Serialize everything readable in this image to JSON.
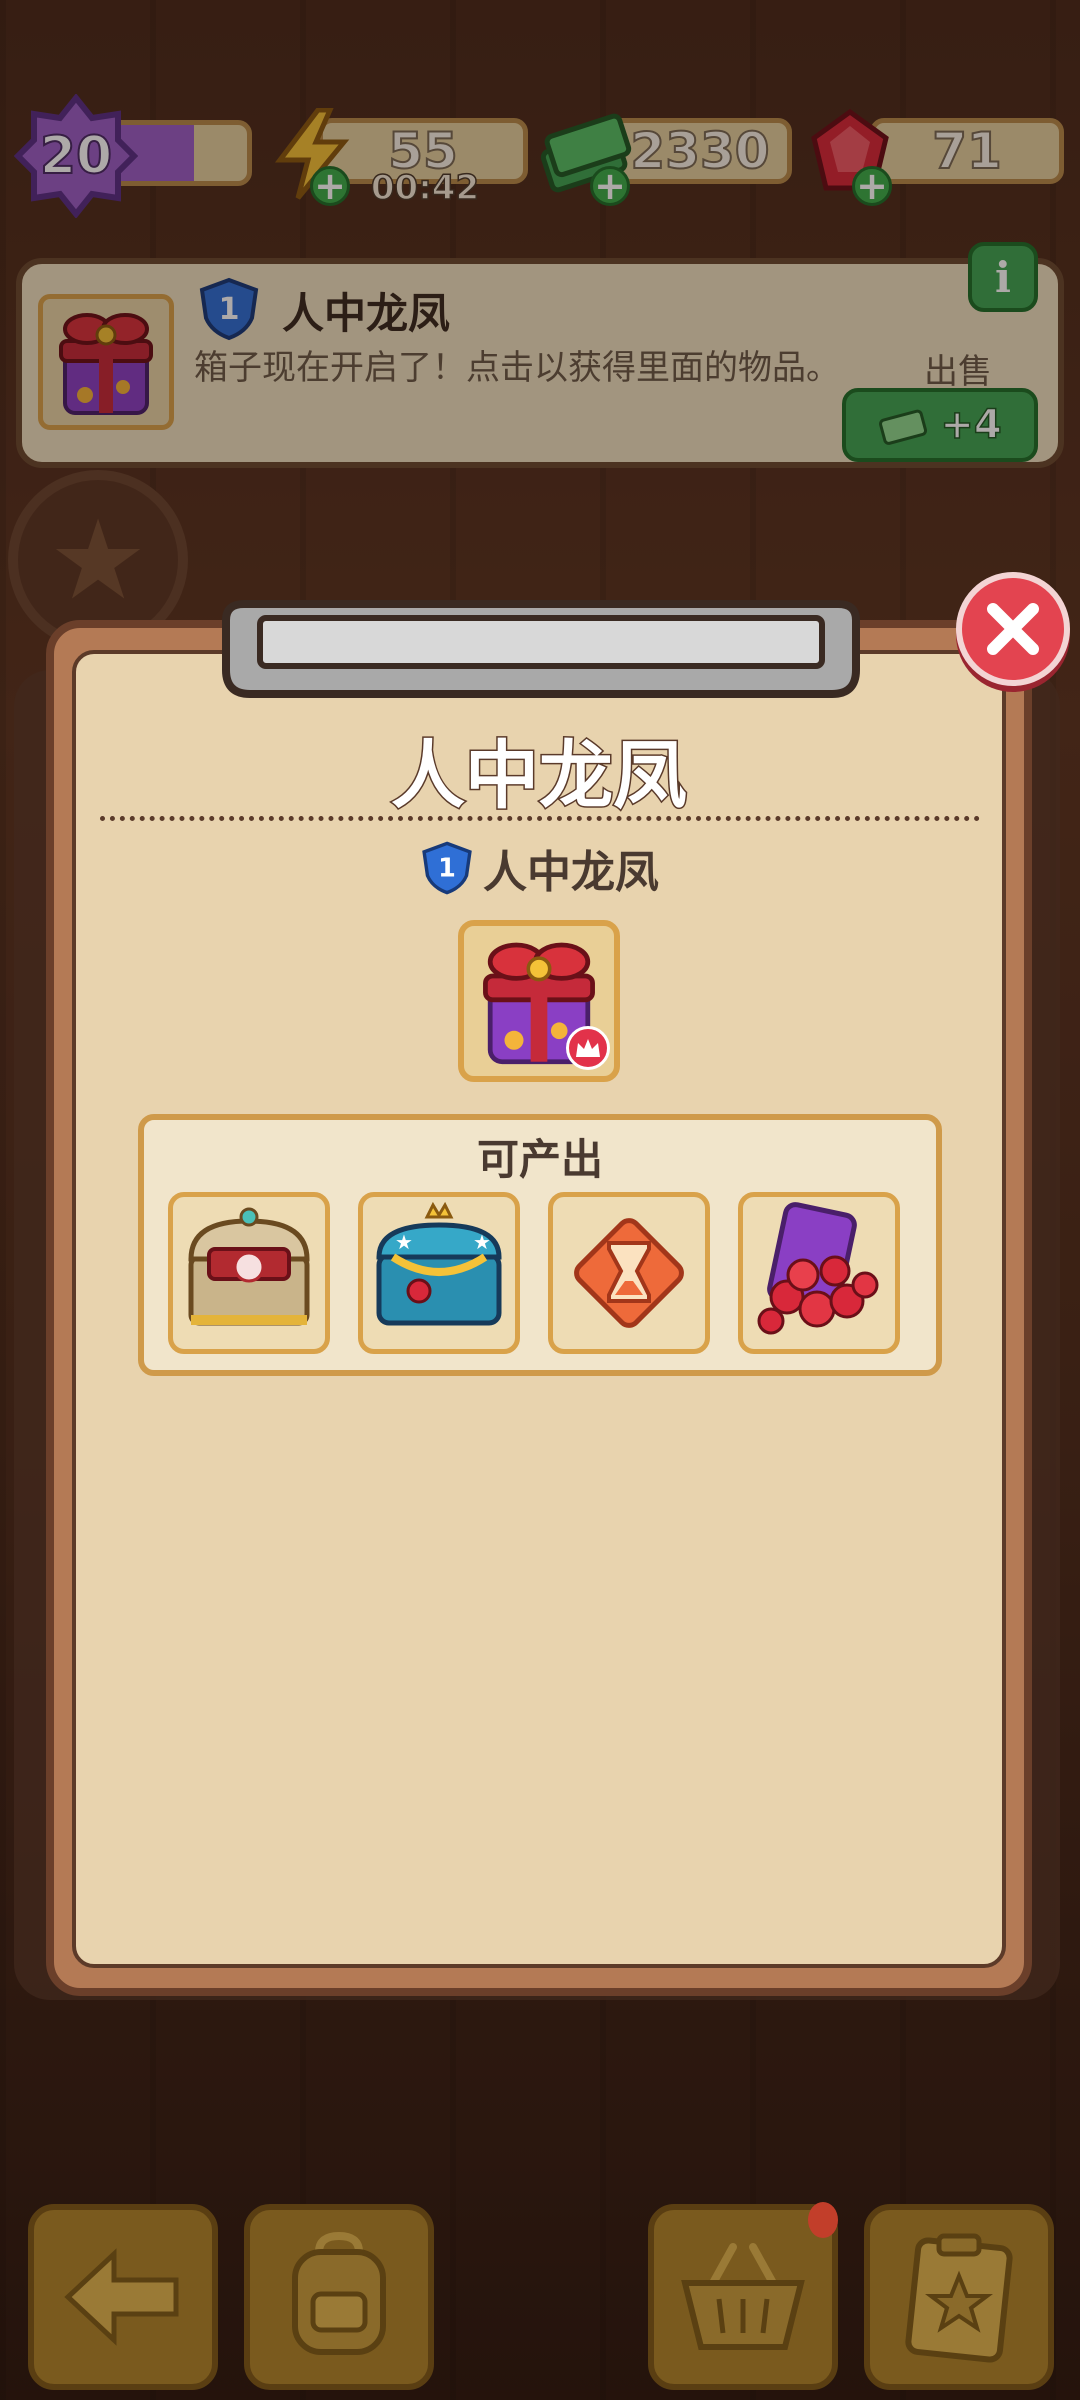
{
  "resources": {
    "level": "20",
    "xp_fraction": 0.6,
    "energy": "55",
    "energy_timer": "00:42",
    "cash": "2330",
    "gems": "71"
  },
  "banner": {
    "item_level": "1",
    "title": "人中龙凤",
    "description": "箱子现在开启了！点击以获得里面的物品。",
    "sell_label": "出售",
    "sell_value": "+4",
    "info_label": "i"
  },
  "modal": {
    "title": "人中龙凤",
    "item_level": "1",
    "item_name": "人中龙凤",
    "produce_title": "可产出",
    "produce_items": [
      {
        "icon": "golden-treasure-chest-icon"
      },
      {
        "icon": "blue-royal-chest-icon"
      },
      {
        "icon": "hourglass-token-icon"
      },
      {
        "icon": "ruby-gem-pile-icon"
      }
    ]
  },
  "colors": {
    "accent_green": "#3fa553",
    "close_red": "#e34450",
    "paper": "#e8d3ae",
    "frame": "#b47a55"
  },
  "bottom_nav": {
    "items": [
      {
        "icon": "back-arrow-icon"
      },
      {
        "icon": "backpack-icon"
      },
      {
        "icon": "shopping-basket-icon"
      },
      {
        "icon": "clipboard-star-icon"
      }
    ]
  }
}
